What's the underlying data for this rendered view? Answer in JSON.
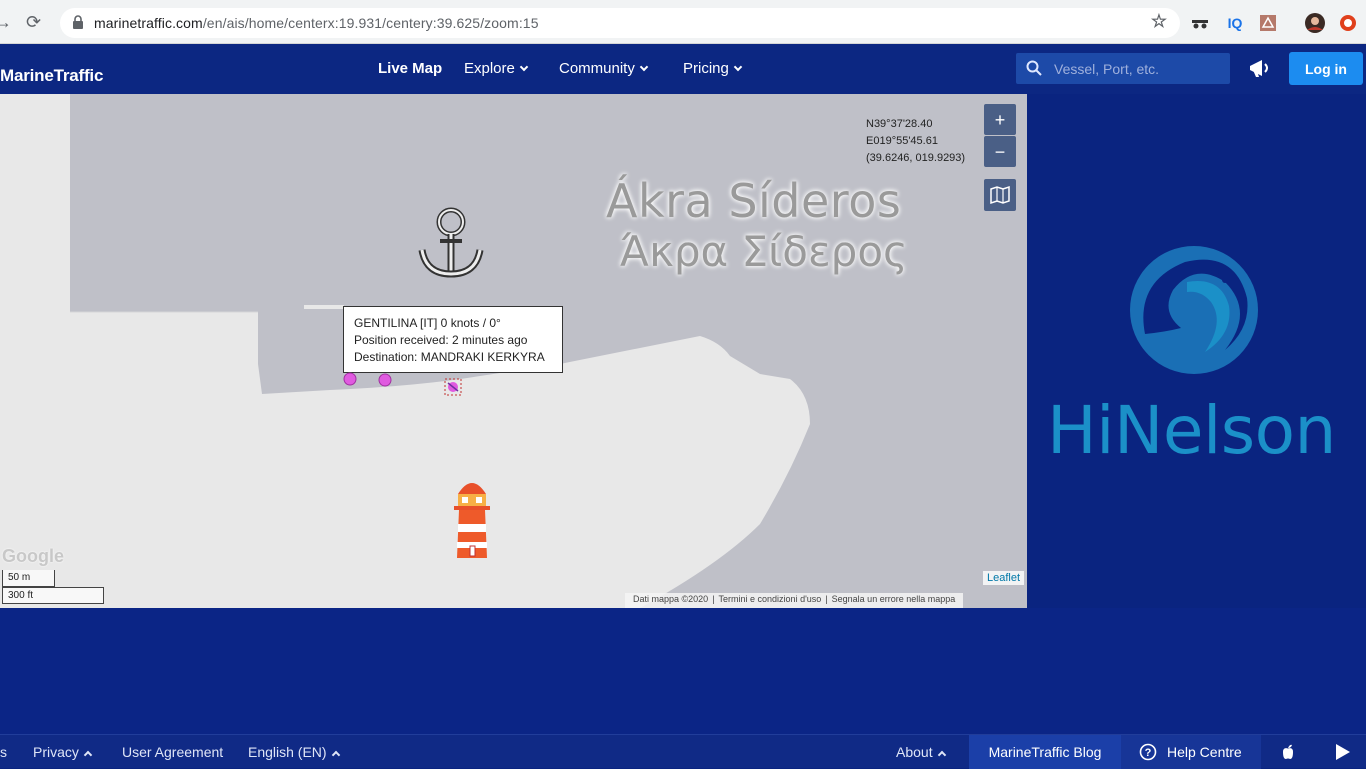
{
  "browser": {
    "url_host": "marinetraffic.com",
    "url_path": "/en/ais/home/centerx:19.931/centery:39.625/zoom:15",
    "bookmark_icon": "star-icon",
    "extensions": [
      "incognito-icon",
      "iq-icon",
      "pdf-icon",
      "profile-icon",
      "opera-icon"
    ],
    "ext_iq_label": "IQ"
  },
  "header": {
    "logo": "MarineTraffic",
    "nav": {
      "live_map": "Live Map",
      "explore": "Explore",
      "community": "Community",
      "pricing": "Pricing"
    },
    "search_placeholder": "Vessel, Port, etc.",
    "login": "Log in"
  },
  "map": {
    "place_name_latin": "Ákra Síderos",
    "place_name_greek": "Άκρα Σίδερος",
    "coords": {
      "lat": "N39°37'28.40",
      "lon": "E019°55'45.61",
      "decimal": "(39.6246, 019.9293)"
    },
    "zoom_in": "+",
    "zoom_out": "−",
    "tooltip": {
      "line1": "GENTILINA [IT] 0 knots / 0°",
      "line2": "Position received: 2 minutes ago",
      "line3": "Destination: MANDRAKI KERKYRA"
    },
    "google": "Google",
    "scale_metric": "50 m",
    "scale_imperial": "300 ft",
    "leaflet": "Leaflet",
    "attribution": {
      "data": "Dati mappa ©2020",
      "terms": "Termini e condizioni d'uso",
      "report": "Segnala un errore nella mappa"
    },
    "colors": {
      "sea": "#bfc0c8",
      "land": "#e8e8e8",
      "vessel_marker": "#e05ae0"
    }
  },
  "brand_watermark": {
    "name": "HiNelson"
  },
  "footer": {
    "partial_left": "s",
    "privacy": "Privacy",
    "user_agreement": "User Agreement",
    "language": "English (EN)",
    "about": "About",
    "blog": "MarineTraffic Blog",
    "help": "Help Centre"
  }
}
